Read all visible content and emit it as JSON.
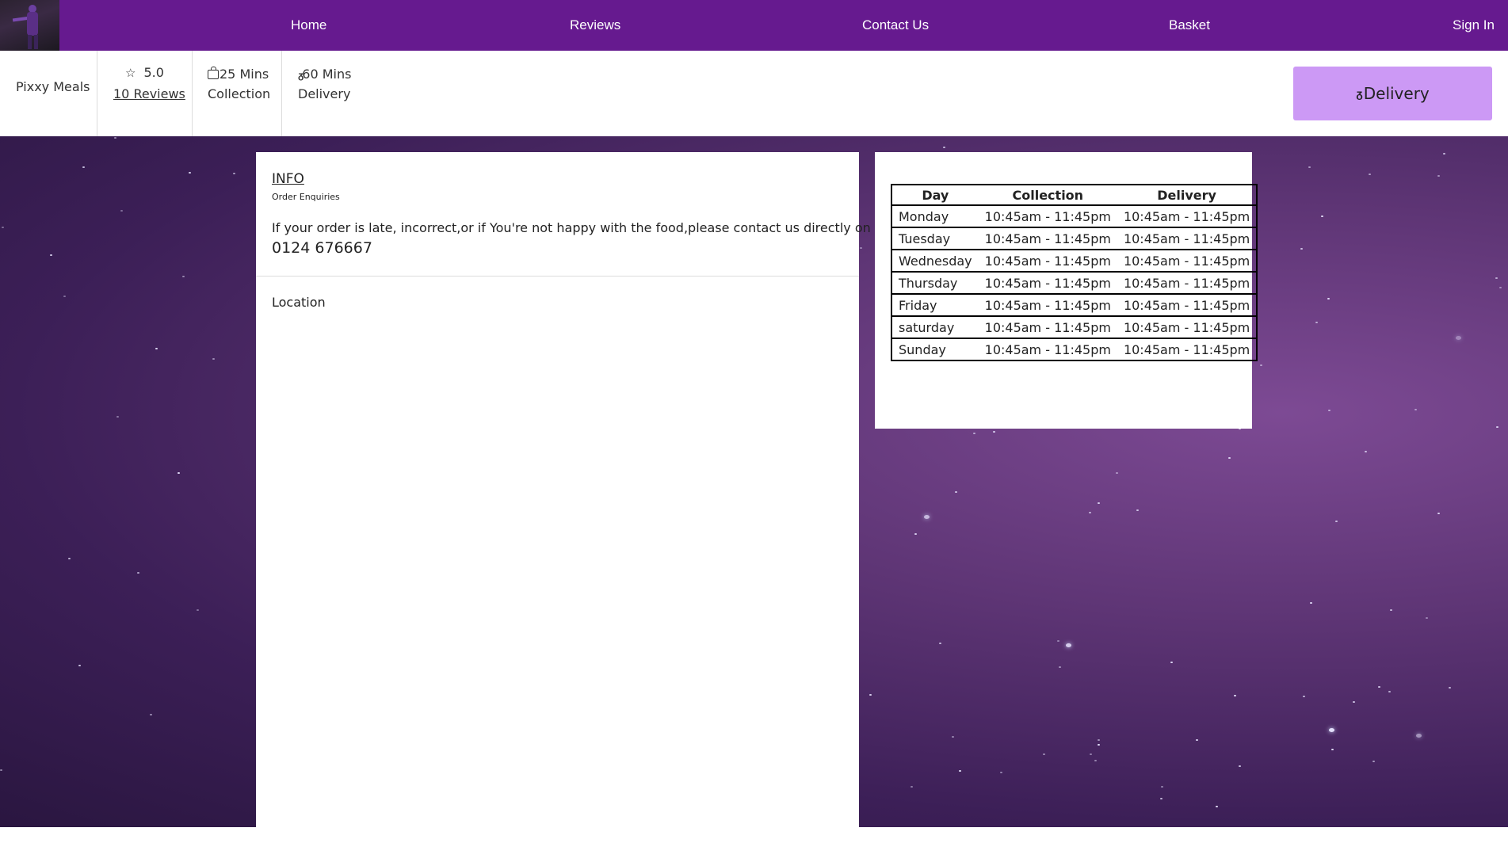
{
  "nav": {
    "logo_icon": "character-logo-icon",
    "links": [
      "Home",
      "Reviews",
      "Contact Us",
      "Basket",
      "Sign In"
    ]
  },
  "restaurant": {
    "name": "Pixxy Meals",
    "rating": "5.0",
    "reviews_link": "10 Reviews",
    "collection_time": "25 Mins",
    "collection_label": "Collection",
    "delivery_time": "60 Mins",
    "delivery_label": "Delivery"
  },
  "delivery_button": {
    "label": "Delivery",
    "icon": "bike-icon"
  },
  "info": {
    "title": "INFO",
    "subtitle": "Order Enquiries",
    "text": "If your order is late, incorrect,or if You're not happy with the food,please contact us directly on",
    "phone": "0124 676667",
    "location_label": "Location"
  },
  "hours": {
    "headers": [
      "Day",
      "Collection",
      "Delivery"
    ],
    "rows": [
      {
        "day": "Monday",
        "collection": "10:45am - 11:45pm",
        "delivery": "10:45am - 11:45pm"
      },
      {
        "day": "Tuesday",
        "collection": "10:45am - 11:45pm",
        "delivery": "10:45am - 11:45pm"
      },
      {
        "day": "Wednesday",
        "collection": "10:45am - 11:45pm",
        "delivery": "10:45am - 11:45pm"
      },
      {
        "day": "Thursday",
        "collection": "10:45am - 11:45pm",
        "delivery": "10:45am - 11:45pm"
      },
      {
        "day": "Friday",
        "collection": "10:45am - 11:45pm",
        "delivery": "10:45am - 11:45pm"
      },
      {
        "day": "saturday",
        "collection": "10:45am - 11:45pm",
        "delivery": "10:45am - 11:45pm"
      },
      {
        "day": "Sunday",
        "collection": "10:45am - 11:45pm",
        "delivery": "10:45am - 11:45pm"
      }
    ]
  },
  "colors": {
    "nav_bg": "#661a8f",
    "delivery_btn_bg": "#cc99f5",
    "background": "#4a2866"
  }
}
